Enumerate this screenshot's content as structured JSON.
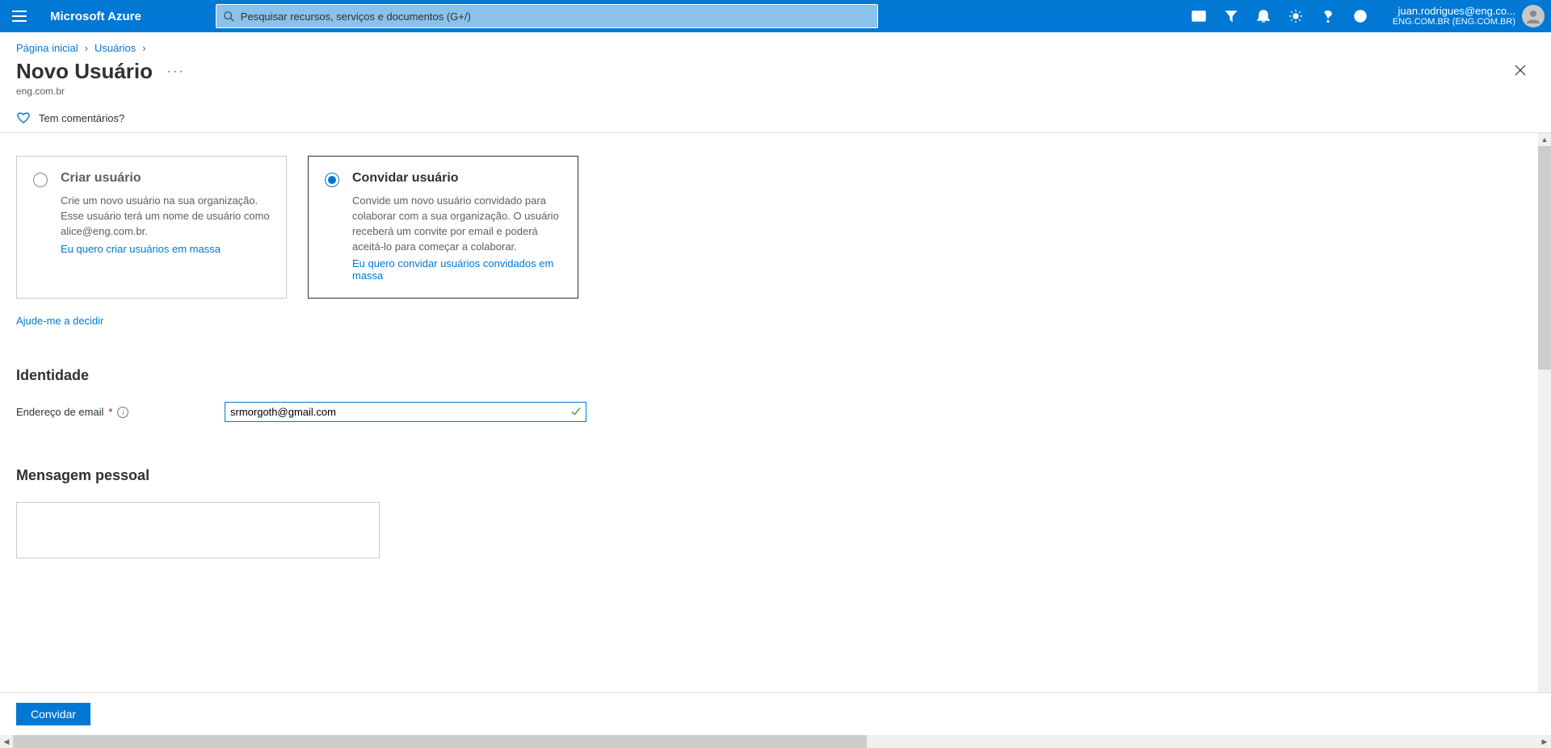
{
  "topbar": {
    "brand": "Microsoft Azure",
    "search_placeholder": "Pesquisar recursos, serviços e documentos (G+/)",
    "account_email": "juan.rodrigues@eng.co...",
    "account_tenant": "ENG.COM.BR (ENG.COM.BR)"
  },
  "breadcrumb": {
    "home": "Página inicial",
    "users": "Usuários"
  },
  "title": {
    "heading": "Novo Usuário",
    "sub": "eng.com.br"
  },
  "feedback_label": "Tem comentários?",
  "cards": {
    "create": {
      "title": "Criar usuário",
      "desc": "Crie um novo usuário na sua organização. Esse usuário terá um nome de usuário como alice@eng.com.br.",
      "link": "Eu quero criar usuários em massa"
    },
    "invite": {
      "title": "Convidar usuário",
      "desc": "Convide um novo usuário convidado para colaborar com a sua organização. O usuário receberá um convite por email e poderá aceitá-lo para começar a colaborar.",
      "link": "Eu quero convidar usuários convidados em massa"
    }
  },
  "help_link": "Ajude-me a decidir",
  "section_identity": "Identidade",
  "email_label": "Endereço de email",
  "email_value": "srmorgoth@gmail.com",
  "section_message": "Mensagem pessoal",
  "message_value": "",
  "footer_button": "Convidar"
}
